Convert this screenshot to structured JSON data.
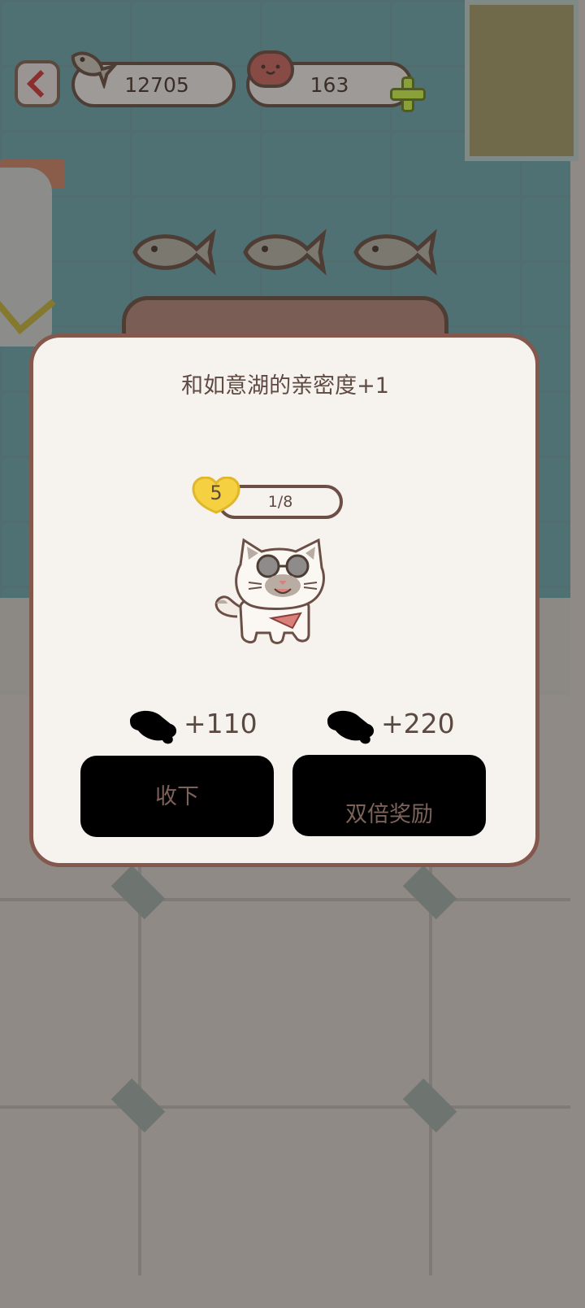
{
  "hud": {
    "fish_count": "12705",
    "heart_count": "163",
    "icons": [
      "back-chevron-icon",
      "fish-icon",
      "heart-face-icon",
      "plus-icon"
    ]
  },
  "dialog": {
    "title": "和如意湖的亲密度+1",
    "level": "5",
    "progress": "1/8",
    "progress_fraction": 0.125
  },
  "rewards": {
    "accept_amount": "+110",
    "double_amount": "+220"
  },
  "buttons": {
    "accept_label": "收下",
    "double_label": "双倍奖励"
  },
  "colors": {
    "dialog_border": "#85584e",
    "dialog_bg": "#f6f3ee",
    "level_heart": "#f5d142",
    "button_bg": "#000000",
    "plus_green": "#8aa13a"
  }
}
